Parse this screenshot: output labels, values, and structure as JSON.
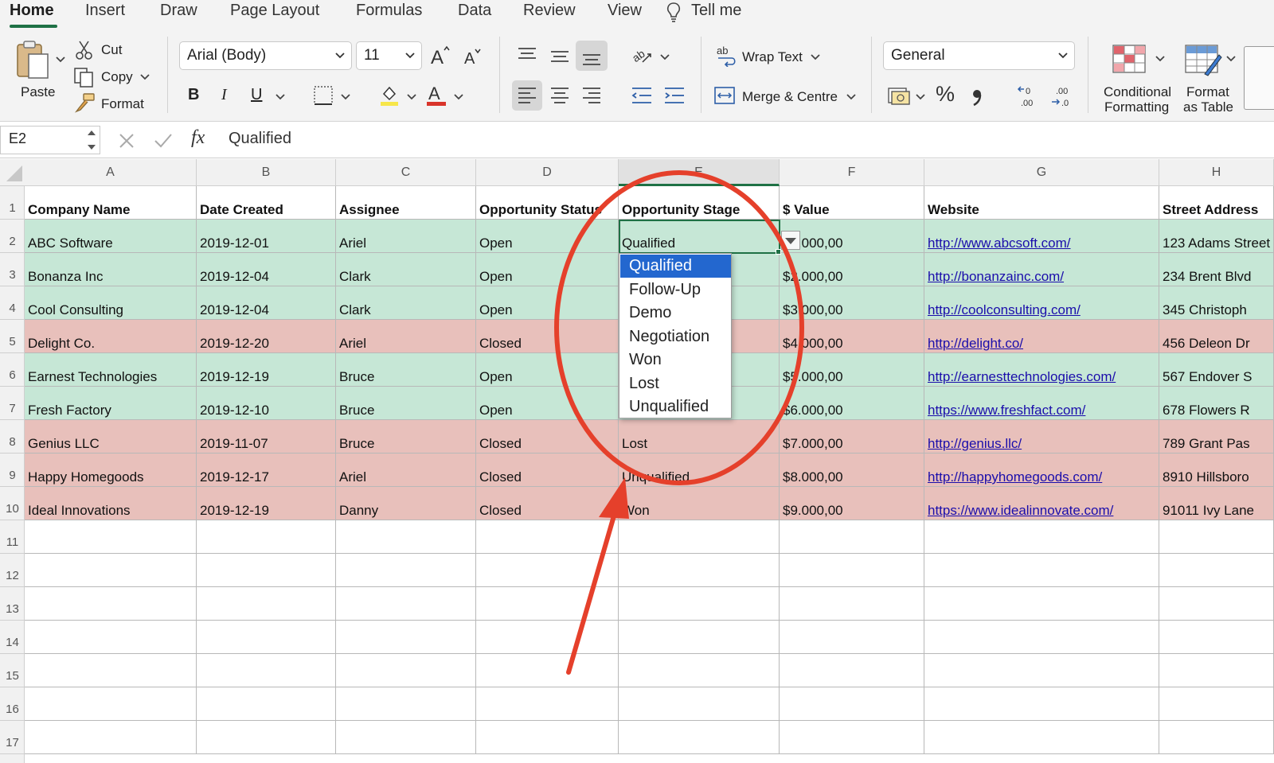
{
  "ribbon": {
    "tabs": [
      "Home",
      "Insert",
      "Draw",
      "Page Layout",
      "Formulas",
      "Data",
      "Review",
      "View",
      "Tell me"
    ],
    "paste_label": "Paste",
    "cut_label": "Cut",
    "copy_label": "Copy",
    "format_label": "Format",
    "font_name": "Arial (Body)",
    "font_size": "11",
    "bold": "B",
    "italic": "I",
    "underline": "U",
    "wrap_text": "Wrap Text",
    "merge_centre": "Merge & Centre",
    "number_format": "General",
    "percent": "%",
    "conditional_formatting": [
      "Conditional",
      "Formatting"
    ],
    "format_as_table": [
      "Format",
      "as Table"
    ]
  },
  "formula_bar": {
    "cell_ref": "E2",
    "fx": "fx",
    "value": "Qualified"
  },
  "sheet": {
    "columns": [
      "A",
      "B",
      "C",
      "D",
      "E",
      "F",
      "G",
      "H"
    ],
    "row_numbers": [
      "1",
      "2",
      "3",
      "4",
      "5",
      "6",
      "7",
      "8",
      "9",
      "10",
      "11",
      "12",
      "13",
      "14",
      "15",
      "16",
      "17"
    ],
    "headers": [
      "Company Name",
      "Date Created",
      "Assignee",
      "Opportunity Status",
      "Opportunity Stage",
      "$ Value",
      "Website",
      "Street Address"
    ],
    "rows": [
      {
        "company": "ABC Software",
        "date": "2019-12-01",
        "assignee": "Ariel",
        "status": "Open",
        "stage": "Qualified",
        "value": "$1.000,00",
        "website": "http://www.abcsoft.com/",
        "street": "123 Adams Street"
      },
      {
        "company": "Bonanza Inc",
        "date": "2019-12-04",
        "assignee": "Clark",
        "status": "Open",
        "stage": "",
        "value": "$2.000,00",
        "website": "http://bonanzainc.com/",
        "street": "234 Brent Blvd"
      },
      {
        "company": "Cool Consulting",
        "date": "2019-12-04",
        "assignee": "Clark",
        "status": "Open",
        "stage": "",
        "value": "$3.000,00",
        "website": "http://coolconsulting.com/",
        "street": "345 Christoph"
      },
      {
        "company": "Delight Co.",
        "date": "2019-12-20",
        "assignee": "Ariel",
        "status": "Closed",
        "stage": "",
        "value": "$4.000,00",
        "website": "http://delight.co/",
        "street": "456 Deleon Dr"
      },
      {
        "company": "Earnest Technologies",
        "date": "2019-12-19",
        "assignee": "Bruce",
        "status": "Open",
        "stage": "",
        "value": "$5.000,00",
        "website": "http://earnesttechnologies.com/",
        "street": "567 Endover S"
      },
      {
        "company": "Fresh Factory",
        "date": "2019-12-10",
        "assignee": "Bruce",
        "status": "Open",
        "stage": "",
        "value": "$6.000,00",
        "website": "https://www.freshfact.com/",
        "street": "678 Flowers R"
      },
      {
        "company": "Genius LLC",
        "date": "2019-11-07",
        "assignee": "Bruce",
        "status": "Closed",
        "stage": "Lost",
        "value": "$7.000,00",
        "website": "http://genius.llc/",
        "street": "789 Grant Pas"
      },
      {
        "company": "Happy Homegoods",
        "date": "2019-12-17",
        "assignee": "Ariel",
        "status": "Closed",
        "stage": "Unqualified",
        "value": "$8.000,00",
        "website": "http://happyhomegoods.com/",
        "street": "8910 Hillsboro"
      },
      {
        "company": "Ideal Innovations",
        "date": "2019-12-19",
        "assignee": "Danny",
        "status": "Closed",
        "stage": "Won",
        "value": "$9.000,00",
        "website": "https://www.idealinnovate.com/",
        "street": "91011 Ivy Lane"
      }
    ]
  },
  "dropdown": {
    "options": [
      "Qualified",
      "Follow-Up",
      "Demo",
      "Negotiation",
      "Won",
      "Lost",
      "Unqualified"
    ],
    "selected": "Qualified"
  },
  "colors": {
    "open_row": "#c6e7d6",
    "closed_row": "#e8c0bb",
    "accent_green": "#1f7145",
    "annotation_red": "#e5402b",
    "selection_blue": "#2367cf"
  }
}
